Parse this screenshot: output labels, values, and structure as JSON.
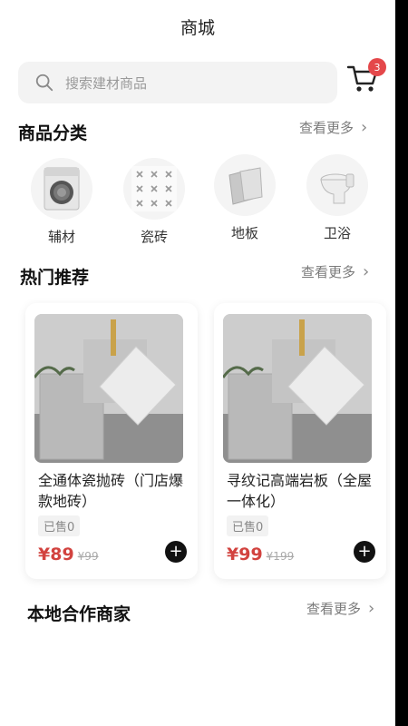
{
  "header": {
    "title": "商城"
  },
  "search": {
    "placeholder": "搜索建材商品"
  },
  "cart": {
    "badge_count": "3"
  },
  "categories_section": {
    "title": "商品分类",
    "more": "查看更多",
    "items": [
      {
        "label": "辅材",
        "icon": "washing-machine-image"
      },
      {
        "label": "瓷砖",
        "icon": "tile-pattern-image"
      },
      {
        "label": "地板",
        "icon": "floor-tiles-image"
      },
      {
        "label": "卫浴",
        "icon": "toilet-image"
      }
    ]
  },
  "hot_section": {
    "title": "热门推荐",
    "more": "查看更多",
    "products": [
      {
        "name": "全通体瓷抛砖（门店爆款地砖）",
        "sold": "已售0",
        "price": "¥89",
        "old_price": "¥99"
      },
      {
        "name": "寻纹记高端岩板（全屋一体化）",
        "sold": "已售0",
        "price": "¥99",
        "old_price": "¥199"
      }
    ]
  },
  "local_section": {
    "title": "本地合作商家",
    "more": "查看更多"
  },
  "colors": {
    "accent": "#d2433f",
    "badge": "#e4474a",
    "background": "#ffffff"
  }
}
